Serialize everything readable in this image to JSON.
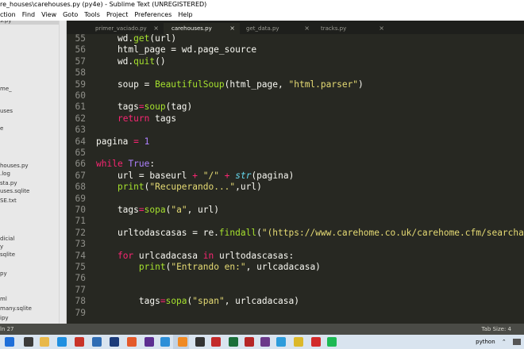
{
  "window": {
    "title": "re_houses\\carehouses.py (py4e) - Sublime Text (UNREGISTERED)"
  },
  "menu": [
    "ction",
    "Find",
    "View",
    "Goto",
    "Tools",
    "Project",
    "Preferences",
    "Help"
  ],
  "sidebar": {
    "items": [
      {
        "label": "s.py",
        "selected": true
      },
      {
        "label": "me_",
        "selected": false
      },
      {
        "label": "uses",
        "selected": false
      },
      {
        "label": "e",
        "selected": false
      },
      {
        "label": "houses.py",
        "selected": false
      },
      {
        "label": ".log",
        "selected": false
      },
      {
        "label": "sta.py",
        "selected": false
      },
      {
        "label": "uses.sqlite",
        "selected": false
      },
      {
        "label": "SE.txt",
        "selected": false
      },
      {
        "label": "dicial",
        "selected": false
      },
      {
        "label": "y",
        "selected": false
      },
      {
        "label": "sqlite",
        "selected": false
      },
      {
        "label": "py",
        "selected": false
      },
      {
        "label": "ml",
        "selected": false
      },
      {
        "label": "many.sqlite",
        "selected": false
      },
      {
        "label": "ipy",
        "selected": false
      }
    ]
  },
  "tabs": [
    {
      "label": "primer_vaciado.py",
      "active": false
    },
    {
      "label": "carehouses.py",
      "active": true
    },
    {
      "label": "get_data.py",
      "active": false
    },
    {
      "label": "tracks.py",
      "active": false
    }
  ],
  "code": {
    "lines": [
      {
        "n": "55",
        "tokens": [
          {
            "t": "    wd."
          },
          {
            "t": "get",
            "c": "fn"
          },
          {
            "t": "(url)"
          }
        ]
      },
      {
        "n": "56",
        "tokens": [
          {
            "t": "    html_page = wd.page_source"
          }
        ]
      },
      {
        "n": "57",
        "tokens": [
          {
            "t": "    wd."
          },
          {
            "t": "quit",
            "c": "fn"
          },
          {
            "t": "()"
          }
        ]
      },
      {
        "n": "58",
        "tokens": [
          {
            "t": ""
          }
        ]
      },
      {
        "n": "59",
        "tokens": [
          {
            "t": "    soup = "
          },
          {
            "t": "BeautifulSoup",
            "c": "fn"
          },
          {
            "t": "(html_page, "
          },
          {
            "t": "\"html.parser\"",
            "c": "st"
          },
          {
            "t": ")"
          }
        ]
      },
      {
        "n": "60",
        "tokens": [
          {
            "t": ""
          }
        ]
      },
      {
        "n": "61",
        "tokens": [
          {
            "t": "    tags"
          },
          {
            "t": "=",
            "c": "kw"
          },
          {
            "t": "soup",
            "c": "fn"
          },
          {
            "t": "(tag)"
          }
        ]
      },
      {
        "n": "62",
        "tokens": [
          {
            "t": "    "
          },
          {
            "t": "return",
            "c": "kw"
          },
          {
            "t": " tags"
          }
        ]
      },
      {
        "n": "63",
        "tokens": [
          {
            "t": ""
          }
        ]
      },
      {
        "n": "64",
        "tokens": [
          {
            "t": "pagina "
          },
          {
            "t": "=",
            "c": "kw"
          },
          {
            "t": " "
          },
          {
            "t": "1",
            "c": "nm"
          }
        ]
      },
      {
        "n": "65",
        "tokens": [
          {
            "t": ""
          }
        ]
      },
      {
        "n": "66",
        "tokens": [
          {
            "t": "while",
            "c": "kw"
          },
          {
            "t": " "
          },
          {
            "t": "True",
            "c": "nm"
          },
          {
            "t": ":"
          }
        ]
      },
      {
        "n": "67",
        "tokens": [
          {
            "t": "    url = baseurl "
          },
          {
            "t": "+",
            "c": "kw"
          },
          {
            "t": " "
          },
          {
            "t": "\"/\"",
            "c": "st"
          },
          {
            "t": " "
          },
          {
            "t": "+",
            "c": "kw"
          },
          {
            "t": " "
          },
          {
            "t": "str",
            "c": "bi"
          },
          {
            "t": "(pagina)"
          }
        ]
      },
      {
        "n": "68",
        "tokens": [
          {
            "t": "    "
          },
          {
            "t": "print",
            "c": "fn"
          },
          {
            "t": "("
          },
          {
            "t": "\"Recuperando...\"",
            "c": "st"
          },
          {
            "t": ",url)"
          }
        ]
      },
      {
        "n": "69",
        "tokens": [
          {
            "t": ""
          }
        ]
      },
      {
        "n": "70",
        "tokens": [
          {
            "t": "    tags"
          },
          {
            "t": "=",
            "c": "kw"
          },
          {
            "t": "sopa",
            "c": "fn"
          },
          {
            "t": "("
          },
          {
            "t": "\"a\"",
            "c": "st"
          },
          {
            "t": ", url)"
          }
        ]
      },
      {
        "n": "71",
        "tokens": [
          {
            "t": ""
          }
        ]
      },
      {
        "n": "72",
        "tokens": [
          {
            "t": "    urltodascasas = re."
          },
          {
            "t": "findall",
            "c": "fn"
          },
          {
            "t": "("
          },
          {
            "t": "\"(https://www.carehome.co.uk/carehome.cfm/searchazre",
            "c": "st"
          }
        ]
      },
      {
        "n": "73",
        "tokens": [
          {
            "t": ""
          }
        ]
      },
      {
        "n": "74",
        "tokens": [
          {
            "t": "    "
          },
          {
            "t": "for",
            "c": "kw"
          },
          {
            "t": " urlcadacasa "
          },
          {
            "t": "in",
            "c": "kw"
          },
          {
            "t": " urltodascasas:"
          }
        ]
      },
      {
        "n": "75",
        "tokens": [
          {
            "t": "        "
          },
          {
            "t": "print",
            "c": "fn"
          },
          {
            "t": "("
          },
          {
            "t": "\"Entrando en:\"",
            "c": "st"
          },
          {
            "t": ", urlcadacasa)"
          }
        ]
      },
      {
        "n": "76",
        "tokens": [
          {
            "t": ""
          }
        ]
      },
      {
        "n": "77",
        "tokens": [
          {
            "t": ""
          }
        ]
      },
      {
        "n": "78",
        "tokens": [
          {
            "t": "        tags"
          },
          {
            "t": "=",
            "c": "kw"
          },
          {
            "t": "sopa",
            "c": "fn"
          },
          {
            "t": "("
          },
          {
            "t": "\"span\"",
            "c": "st"
          },
          {
            "t": ", urlcadacasa)"
          }
        ]
      },
      {
        "n": "79",
        "tokens": [
          {
            "t": ""
          }
        ]
      }
    ]
  },
  "statusbar": {
    "left": "ln 27",
    "tab_size": "Tab Size: 4"
  },
  "taskbar": {
    "icons": [
      {
        "name": "start-icon",
        "color": "#1e6fd9"
      },
      {
        "name": "search-icon",
        "color": "#3b3b3b"
      },
      {
        "name": "file-explorer-icon",
        "color": "#e8b84a"
      },
      {
        "name": "edge-icon",
        "color": "#1f8fe0"
      },
      {
        "name": "pdf-icon",
        "color": "#c8342a"
      },
      {
        "name": "app-icon-1",
        "color": "#2f6db4"
      },
      {
        "name": "app-icon-2",
        "color": "#1b3b7a"
      },
      {
        "name": "app-icon-3",
        "color": "#e45a2b"
      },
      {
        "name": "app-icon-4",
        "color": "#5d2f91"
      },
      {
        "name": "vscode-icon",
        "color": "#2d8fd8"
      },
      {
        "name": "sublime-icon",
        "color": "#f08a24"
      },
      {
        "name": "app-icon-5",
        "color": "#333333"
      },
      {
        "name": "app-icon-6",
        "color": "#c32b2b"
      },
      {
        "name": "app-icon-7",
        "color": "#1b6f3a"
      },
      {
        "name": "filezilla-icon",
        "color": "#b52626"
      },
      {
        "name": "app-icon-8",
        "color": "#6b3a8a"
      },
      {
        "name": "app-icon-9",
        "color": "#2d9cdb"
      },
      {
        "name": "chrome-icon",
        "color": "#dcb82a"
      },
      {
        "name": "opera-icon",
        "color": "#d22b2b"
      },
      {
        "name": "spotify-icon",
        "color": "#1db954"
      }
    ],
    "tray": {
      "python_label": "python",
      "chevron": "⌃"
    }
  },
  "colors": {
    "editor_bg": "#272822",
    "keyword": "#f92672",
    "function": "#a6e22e",
    "string": "#e6db74",
    "number": "#ae81ff",
    "builtin": "#66d9ef"
  }
}
